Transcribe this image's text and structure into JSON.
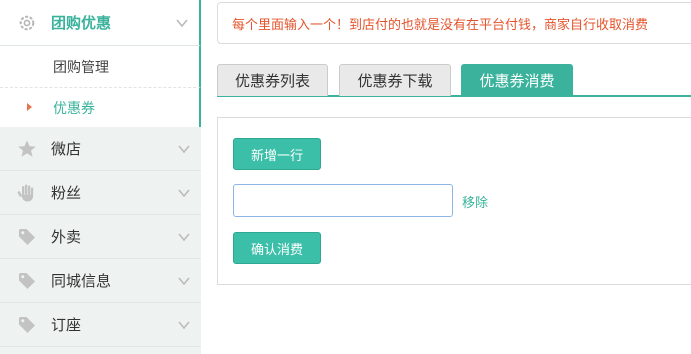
{
  "sidebar": {
    "items": [
      {
        "label": "团购优惠",
        "icon": "gear-icon",
        "state": "expanded"
      },
      {
        "label": "团购管理",
        "type": "sub"
      },
      {
        "label": "优惠券",
        "type": "sub",
        "state": "current"
      },
      {
        "label": "微店",
        "icon": "star-icon"
      },
      {
        "label": "粉丝",
        "icon": "hand-icon"
      },
      {
        "label": "外卖",
        "icon": "tag-icon"
      },
      {
        "label": "同城信息",
        "icon": "tag-icon"
      },
      {
        "label": "订座",
        "icon": "tag-icon"
      }
    ]
  },
  "notice": {
    "text": "每个里面输入一个！到店付的也就是没有在平台付钱，商家自行收取消费"
  },
  "tabs": [
    {
      "label": "优惠券列表"
    },
    {
      "label": "优惠券下载"
    },
    {
      "label": "优惠券消费",
      "active": true
    }
  ],
  "form": {
    "add_row_label": "新增一行",
    "code_input_value": "",
    "code_input_placeholder": "",
    "remove_label": "移除",
    "confirm_label": "确认消费"
  },
  "colors": {
    "accent": "#3bb39c",
    "button": "#3bbfa8",
    "notice": "#e4542c",
    "sidebar_bg": "#eef3f2"
  }
}
